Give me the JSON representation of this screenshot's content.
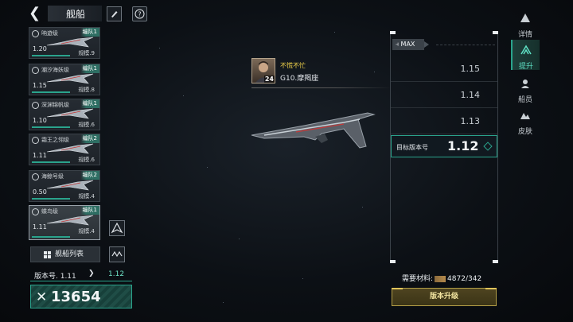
{
  "header": {
    "back_icon": "back-arrow-icon",
    "title": "舰船",
    "action_icons": [
      "brush-icon",
      "help-icon"
    ]
  },
  "ship_list": [
    {
      "name": "呐遊级",
      "fleet": "编队1",
      "version": "1.20",
      "scale": "规模.9",
      "class_icon": "circle-x-icon"
    },
    {
      "name": "潮汐海妖级",
      "fleet": "编队1",
      "version": "1.15",
      "scale": "规模.8",
      "class_icon": "flame-icon"
    },
    {
      "name": "深渊锦帆级",
      "fleet": "编队1",
      "version": "1.10",
      "scale": "规模.6",
      "class_icon": "circle-x-icon"
    },
    {
      "name": "霜王之翎级",
      "fleet": "编队2",
      "version": "1.11",
      "scale": "规模.6",
      "class_icon": "flame-icon"
    },
    {
      "name": "海鲸号级",
      "fleet": "编队2",
      "version": "0.50",
      "scale": "规模.4",
      "class_icon": "flame-icon"
    },
    {
      "name": "蝶鸟级",
      "fleet": "编队1",
      "version": "1.11",
      "scale": "规模.4",
      "class_icon": "flame-icon",
      "selected": true
    }
  ],
  "ship_list_button": "舰船列表",
  "version_summary": {
    "current": "版本号. 1.11",
    "next": "1.12"
  },
  "power": "13654",
  "captain": {
    "name": "不慌不忙",
    "level": "24",
    "location": "G10.摩羯座"
  },
  "version_panel": {
    "max_label": "MAX",
    "versions": [
      "1.15",
      "1.14",
      "1.13"
    ],
    "target_label": "目标版本号",
    "target_value": "1.12"
  },
  "materials": {
    "label": "需要材料:",
    "have": "4872",
    "need": "/342"
  },
  "upgrade_button": "版本升级",
  "nav": [
    {
      "label": "详情",
      "icon": "info-icon"
    },
    {
      "label": "提升",
      "icon": "upgrade-icon",
      "active": true
    },
    {
      "label": "船员",
      "icon": "crew-icon"
    },
    {
      "label": "皮肤",
      "icon": "skin-icon"
    }
  ],
  "colors": {
    "accent": "#2aa38c",
    "accent_bright": "#5ee0c4",
    "gold": "#b39e46",
    "captain_name": "#f0d24a"
  }
}
